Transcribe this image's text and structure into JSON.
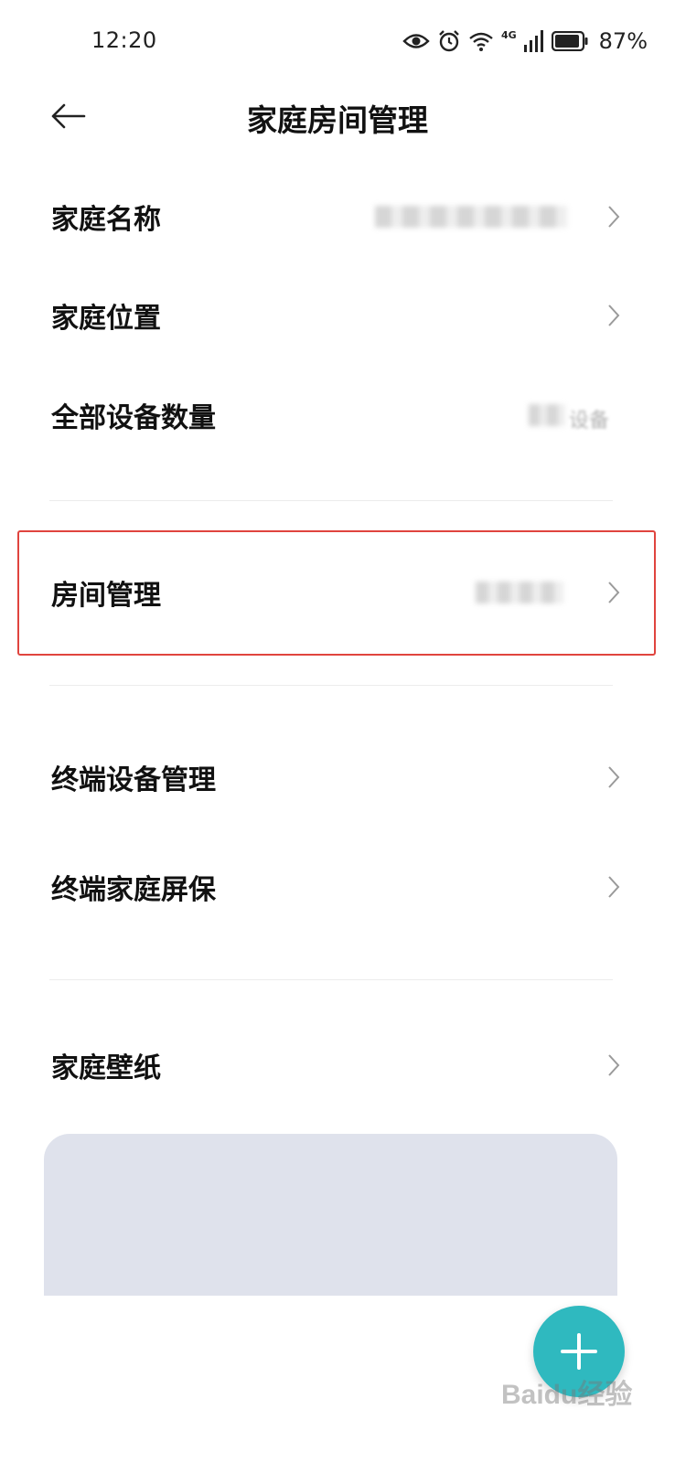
{
  "status_bar": {
    "time": "12:20",
    "network": "4G",
    "battery": "87%"
  },
  "header": {
    "title": "家庭房间管理"
  },
  "rows": [
    {
      "label": "家庭名称",
      "value": "",
      "chevron": true
    },
    {
      "label": "家庭位置",
      "value": "",
      "chevron": true
    },
    {
      "label": "全部设备数量",
      "value": "设备",
      "chevron": false
    },
    {
      "label": "房间管理",
      "value": "",
      "chevron": true
    },
    {
      "label": "终端设备管理",
      "value": "",
      "chevron": true
    },
    {
      "label": "终端家庭屏保",
      "value": "",
      "chevron": true
    },
    {
      "label": "家庭壁纸",
      "value": "",
      "chevron": true
    }
  ],
  "fab": {
    "icon": "plus-icon"
  },
  "watermark": {
    "text": "Baidu经验"
  },
  "colors": {
    "highlight": "#e0443e",
    "fab": "#2fb9bf",
    "card": "#dfe2ec"
  }
}
